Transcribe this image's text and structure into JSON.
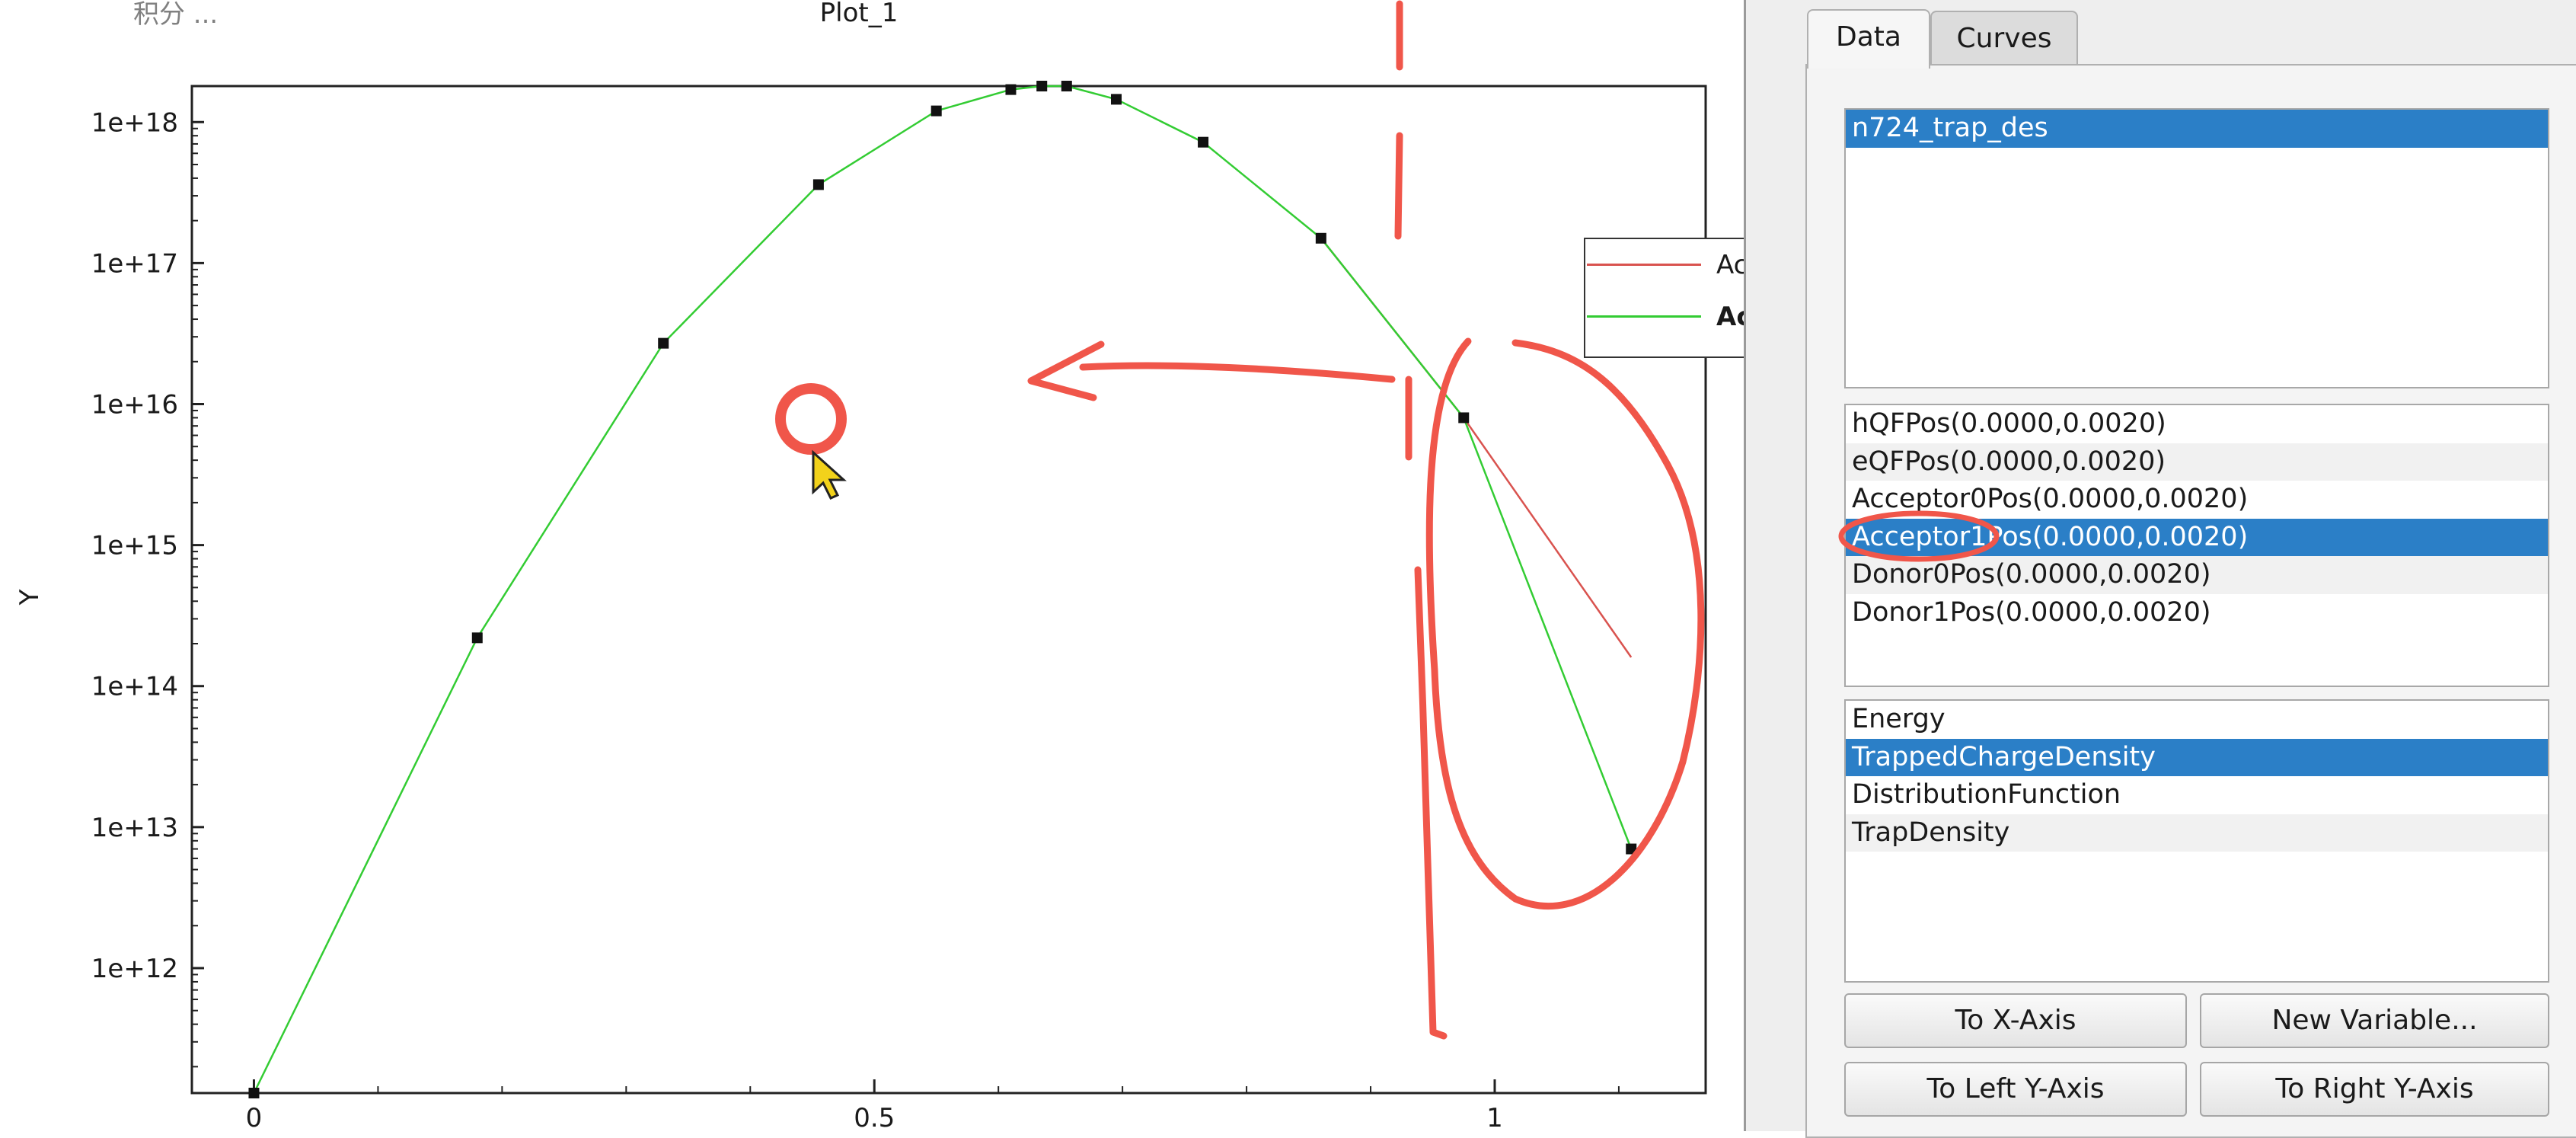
{
  "plot": {
    "title": "Plot_1",
    "top_partial_text": "积分 ...",
    "ylabel": "Y"
  },
  "legend": {
    "entries": [
      {
        "label": "Ac",
        "color": "#d9534f",
        "bold": false
      },
      {
        "label": "Ac",
        "color": "#33cc33",
        "bold": true
      }
    ]
  },
  "chart_data": {
    "type": "line",
    "title": "Plot_1",
    "xlabel": "",
    "ylabel": "Y",
    "y_scale": "log",
    "xlim": [
      -0.05,
      1.17
    ],
    "ylim": [
      130000000000.0,
      1.8e+18
    ],
    "x_ticks": [
      0,
      0.5,
      1
    ],
    "x_tick_labels": [
      "0",
      "0.5",
      "1"
    ],
    "y_ticks": [
      1000000000000.0,
      10000000000000.0,
      100000000000000.0,
      1000000000000000.0,
      1e+16,
      1e+17,
      1e+18
    ],
    "y_tick_labels": [
      "1e+12",
      "1e+13",
      "1e+14",
      "1e+15",
      "1e+16",
      "1e+17",
      "1e+18"
    ],
    "grid": false,
    "legend_position": "top-right",
    "series": [
      {
        "color": "#d9534f",
        "x": [
          0.86,
          0.975,
          1.11
        ],
        "y": [
          1.5e+17,
          8000000000000000.0,
          160000000000000.0
        ]
      },
      {
        "color": "#33cc33",
        "x": [
          0,
          0.18,
          0.33,
          0.455,
          0.55,
          0.61,
          0.635,
          0.655,
          0.695,
          0.765,
          0.86,
          0.975,
          1.11
        ],
        "y": [
          130000000000.0,
          220000000000000.0,
          2.7e+16,
          3.6e+17,
          1.2e+18,
          1.7e+18,
          1.8e+18,
          1.8e+18,
          1.45e+18,
          7.2e+17,
          1.5e+17,
          8000000000000000.0,
          7000000000000.0
        ]
      }
    ],
    "markers_x": [
      0,
      0.18,
      0.33,
      0.455,
      0.55,
      0.61,
      0.635,
      0.655,
      0.695,
      0.765,
      0.86,
      0.975,
      1.11
    ],
    "markers_y": [
      130000000000.0,
      220000000000000.0,
      2.7e+16,
      3.6e+17,
      1.2e+18,
      1.7e+18,
      1.8e+18,
      1.8e+18,
      1.45e+18,
      7.2e+17,
      1.5e+17,
      8000000000000000.0,
      7000000000000.0
    ]
  },
  "tabs": [
    {
      "label": "Data",
      "active": true
    },
    {
      "label": "Curves",
      "active": false
    }
  ],
  "datasets": {
    "items": [
      {
        "label": "n724_trap_des",
        "selected": true
      }
    ]
  },
  "positions": {
    "items": [
      {
        "label": "hQFPos(0.0000,0.0020)",
        "selected": false
      },
      {
        "label": "eQFPos(0.0000,0.0020)",
        "selected": false
      },
      {
        "label": "Acceptor0Pos(0.0000,0.0020)",
        "selected": false
      },
      {
        "label": "Acceptor1Pos(0.0000,0.0020)",
        "selected": true
      },
      {
        "label": "Donor0Pos(0.0000,0.0020)",
        "selected": false
      },
      {
        "label": "Donor1Pos(0.0000,0.0020)",
        "selected": false
      }
    ]
  },
  "variables": {
    "items": [
      {
        "label": "Energy",
        "selected": false
      },
      {
        "label": "TrappedChargeDensity",
        "selected": true
      },
      {
        "label": "DistributionFunction",
        "selected": false
      },
      {
        "label": "TrapDensity",
        "selected": false
      }
    ]
  },
  "buttons": {
    "to_x_axis": "To X-Axis",
    "new_variable": "New Variable...",
    "to_left_y_axis": "To Left Y-Axis",
    "to_right_y_axis": "To Right Y-Axis"
  },
  "colors": {
    "selection": "#2b7fc7",
    "annotation": "#f0564a",
    "cursor": "#f2d21b"
  }
}
